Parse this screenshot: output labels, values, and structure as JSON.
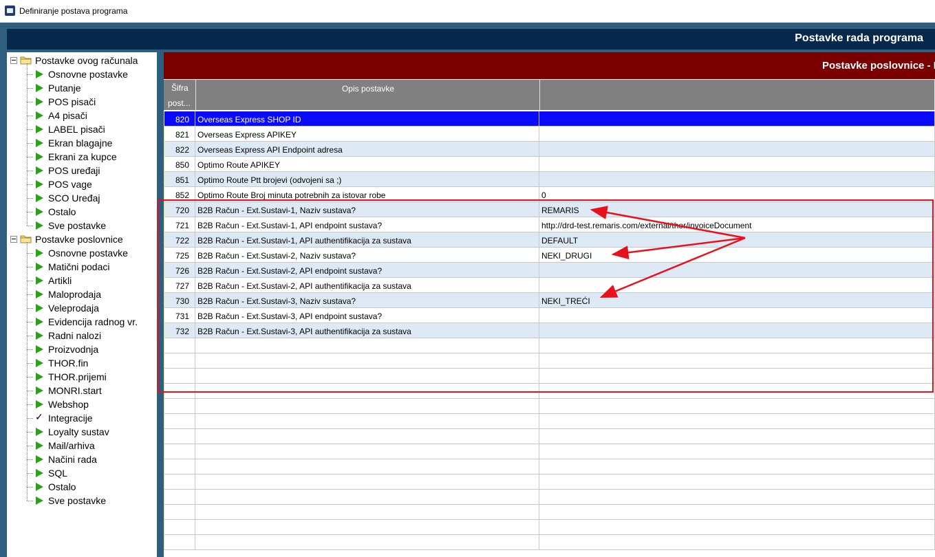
{
  "window": {
    "title": "Definiranje postava programa"
  },
  "header": {
    "title": "Postavke rada programa"
  },
  "panel": {
    "title": "Postavke poslovnice - I"
  },
  "columns": {
    "code": "Šifra post...",
    "code_l1": "Šifra",
    "code_l2": "post...",
    "description": "Opis postavke",
    "value": ""
  },
  "tree": {
    "group1": {
      "label": "Postavke ovog računala",
      "items": [
        "Osnovne postavke",
        "Putanje",
        "POS pisači",
        "A4 pisači",
        "LABEL pisači",
        "Ekran blagajne",
        "Ekrani za kupce",
        "POS uređaji",
        "POS vage",
        "SCO Uređaj",
        "Ostalo",
        "Sve postavke"
      ]
    },
    "group2": {
      "label": "Postavke poslovnice",
      "items": [
        "Osnovne postavke",
        "Matični podaci",
        "Artikli",
        "Maloprodaja",
        "Veleprodaja",
        "Evidencija radnog vr.",
        "Radni nalozi",
        "Proizvodnja",
        "THOR.fin",
        "THOR.prijemi",
        "MONRI.start",
        "Webshop",
        "Integracije",
        "Loyalty sustav",
        "Mail/arhiva",
        "Načini rada",
        "SQL",
        "Ostalo",
        "Sve postavke"
      ],
      "selected": "Integracije"
    }
  },
  "rows": [
    {
      "code": "820",
      "desc": "Overseas Express SHOP ID",
      "value": ""
    },
    {
      "code": "821",
      "desc": "Overseas Express APIKEY",
      "value": ""
    },
    {
      "code": "822",
      "desc": "Overseas Express API Endpoint adresa",
      "value": ""
    },
    {
      "code": "850",
      "desc": "Optimo Route APIKEY",
      "value": ""
    },
    {
      "code": "851",
      "desc": "Optimo Route Ptt brojevi (odvojeni sa ;)",
      "value": ""
    },
    {
      "code": "852",
      "desc": "Optimo Route Broj minuta potrebnih za istovar robe",
      "value": "0"
    },
    {
      "code": "720",
      "desc": "B2B Račun - Ext.Sustavi-1, Naziv sustava?",
      "value": "REMARIS"
    },
    {
      "code": "721",
      "desc": "B2B Račun - Ext.Sustavi-1, API endpoint sustava?",
      "value": "http://drd-test.remaris.com/external/thor/invoiceDocument"
    },
    {
      "code": "722",
      "desc": "B2B Račun - Ext.Sustavi-1, API authentifikacija za sustava",
      "value": "DEFAULT"
    },
    {
      "code": "725",
      "desc": "B2B Račun - Ext.Sustavi-2, Naziv sustava?",
      "value": "NEKI_DRUGI"
    },
    {
      "code": "726",
      "desc": "B2B Račun - Ext.Sustavi-2, API endpoint sustava?",
      "value": ""
    },
    {
      "code": "727",
      "desc": "B2B Račun - Ext.Sustavi-2, API authentifikacija za sustava",
      "value": ""
    },
    {
      "code": "730",
      "desc": "B2B Račun - Ext.Sustavi-3, Naziv sustava?",
      "value": "NEKI_TREĆI"
    },
    {
      "code": "731",
      "desc": "B2B Račun - Ext.Sustavi-3, API endpoint sustava?",
      "value": ""
    },
    {
      "code": "732",
      "desc": "B2B Račun - Ext.Sustavi-3, API authentifikacija za sustava",
      "value": ""
    }
  ],
  "selected_row": "820",
  "colors": {
    "selected": "#0a0aff",
    "header": "#06294b",
    "panel": "#7a0000",
    "annotation": "#e8101a",
    "tree_arrow": "#2aa317"
  }
}
